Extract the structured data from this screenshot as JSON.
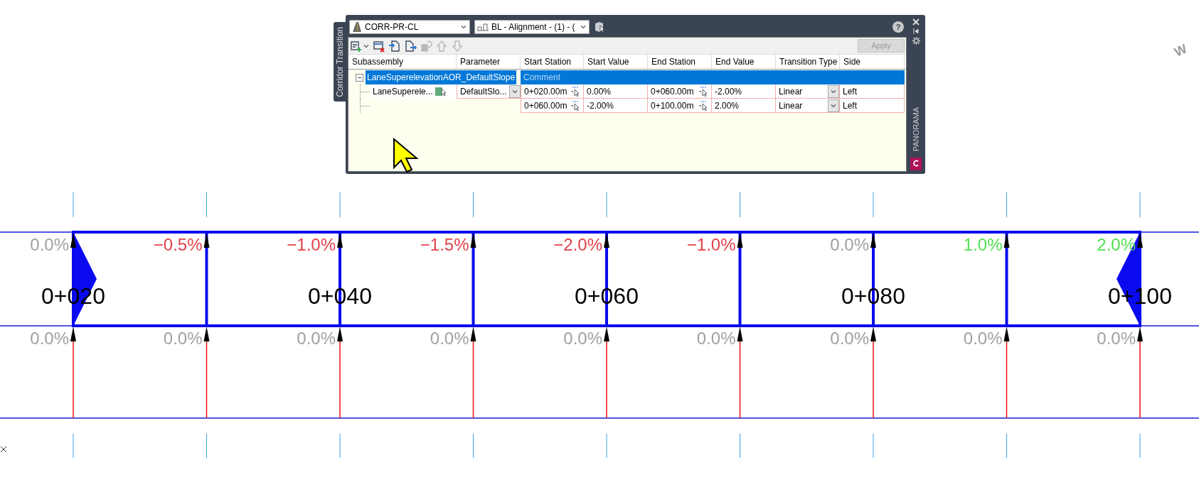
{
  "panel": {
    "side_tab": "Corridor Transition",
    "corridor_dropdown": {
      "value": "CORR-PR-CL"
    },
    "baseline_dropdown": {
      "value": "BL - Alignment - (1) - ("
    },
    "toolbar": [
      {
        "kind": "add",
        "disabled": false
      },
      {
        "kind": "delete",
        "disabled": false
      },
      {
        "kind": "import",
        "disabled": false
      },
      {
        "kind": "export",
        "disabled": false
      },
      {
        "kind": "refresh",
        "disabled": true
      },
      {
        "kind": "up",
        "disabled": true
      },
      {
        "kind": "down",
        "disabled": true
      }
    ],
    "help_label": "?",
    "apply_button": {
      "label": "Apply",
      "disabled": true
    },
    "columns": [
      "Subassembly",
      "Parameter",
      "Start Station",
      "Start Value",
      "End Station",
      "End Value",
      "Transition Type",
      "Side"
    ],
    "rows": [
      {
        "kind": "group",
        "label": "LaneSuperelevationAOR_DefaultSlope",
        "comment": "Comment",
        "expanded": true,
        "selected": true
      },
      {
        "kind": "transition",
        "selected": false,
        "subassembly": "LaneSuperele...",
        "parameter": "DefaultSlo...",
        "start_station": "0+020.00m",
        "start_value": "0.00%",
        "end_station": "0+060.00m",
        "end_value": "-2.00%",
        "transition_type": "Linear",
        "side": "Left"
      },
      {
        "kind": "transition",
        "selected": false,
        "start_station": "0+060.00m",
        "start_value": "-2.00%",
        "end_station": "0+100.00m",
        "end_value": "2.00%",
        "transition_type": "Linear",
        "side": "Left"
      }
    ],
    "palette_label": "PANORAMA"
  },
  "drawing": {
    "compass_label": "W",
    "top_slopes": [
      {
        "text": "0.0%",
        "color": "#a0a0a0"
      },
      {
        "text": "−0.5%",
        "color": "#e0404a"
      },
      {
        "text": "−1.0%",
        "color": "#e0404a"
      },
      {
        "text": "−1.5%",
        "color": "#e0404a"
      },
      {
        "text": "−2.0%",
        "color": "#e0404a"
      },
      {
        "text": "−1.0%",
        "color": "#e0404a"
      },
      {
        "text": "0.0%",
        "color": "#a0a0a0"
      },
      {
        "text": "1.0%",
        "color": "#50e050"
      },
      {
        "text": "2.0%",
        "color": "#50e050"
      }
    ],
    "bottom_slopes": [
      "0.0%",
      "0.0%",
      "0.0%",
      "0.0%",
      "0.0%",
      "0.0%",
      "0.0%",
      "0.0%",
      "0.0%"
    ],
    "station_labels": [
      "0+020",
      "0+040",
      "0+060",
      "0+080",
      "0+100"
    ]
  }
}
